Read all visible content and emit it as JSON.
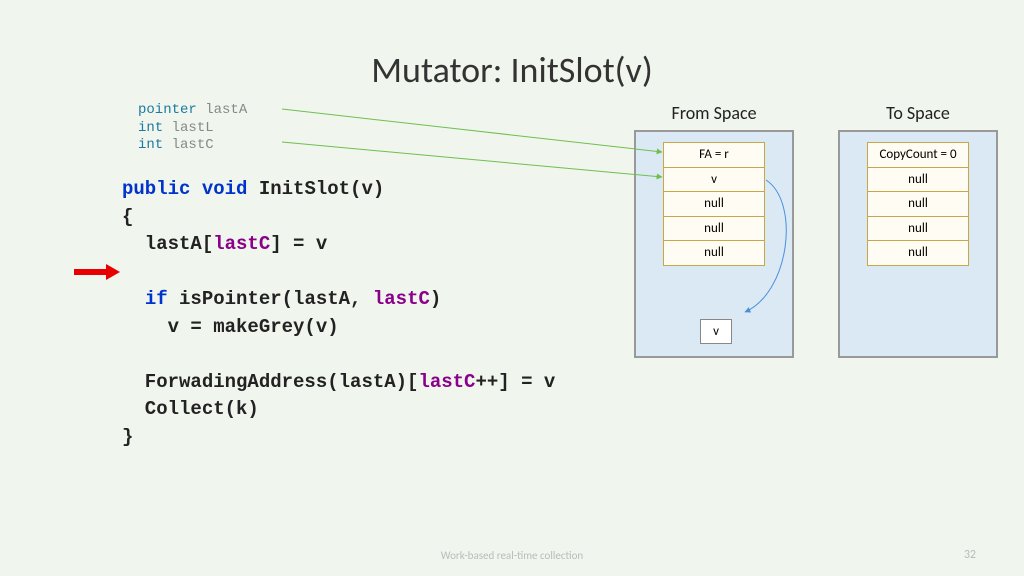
{
  "title": "Mutator: InitSlot(v)",
  "vars": {
    "line1": {
      "type": "pointer",
      "name": "lastA"
    },
    "line2": {
      "type": "int",
      "name": "lastL"
    },
    "line3": {
      "type": "int",
      "name": "lastC"
    }
  },
  "code": {
    "sig": {
      "kw1": "public",
      "kw2": "void",
      "name": "InitSlot(v)"
    },
    "open": "{",
    "l1": {
      "pre": "  lastA[",
      "ident": "lastC",
      "post": "] = v"
    },
    "l2": {
      "kw": "if",
      "pre": " isPointer(lastA, ",
      "ident": "lastC",
      "post": ")"
    },
    "l3": "    v = makeGrey(v)",
    "l4": {
      "pre": "  ForwadingAddress(lastA)[",
      "ident": "lastC",
      "post": "++] = v"
    },
    "l5": "  Collect(k)",
    "close": "}"
  },
  "from_space": {
    "label": "From Space",
    "cells": [
      "FA = r",
      "v",
      "null",
      "null",
      "null"
    ],
    "extra_box": "v"
  },
  "to_space": {
    "label": "To Space",
    "cells": [
      "CopyCount = 0",
      "null",
      "null",
      "null",
      "null"
    ]
  },
  "footer": "Work-based real-time collection",
  "page_num": "32"
}
